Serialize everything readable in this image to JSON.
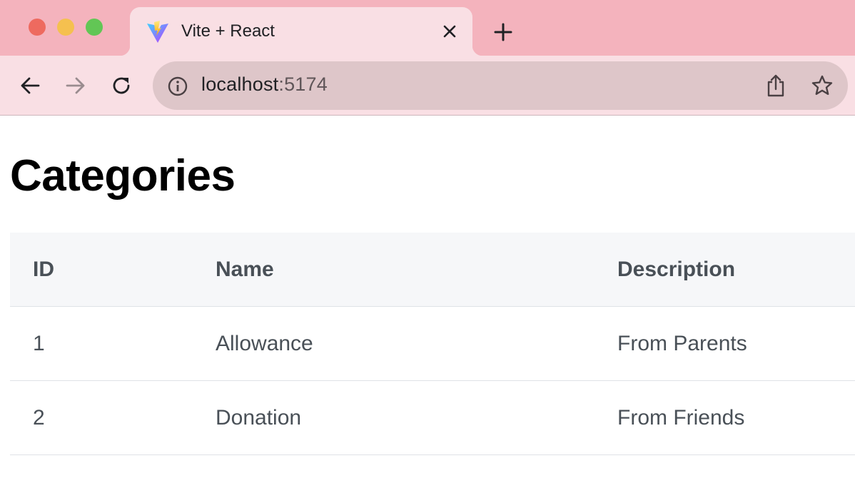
{
  "browser": {
    "tab": {
      "title": "Vite + React",
      "favicon": "vite-logo-icon"
    },
    "address_bar": {
      "host": "localhost",
      "port": ":5174"
    },
    "colors": {
      "tabstrip": "#f4b3bd",
      "toolbar": "#f9dfe4",
      "omnibox": "#dec6c9"
    }
  },
  "page": {
    "title": "Categories",
    "table": {
      "columns": [
        "ID",
        "Name",
        "Description"
      ],
      "rows": [
        {
          "id": "1",
          "name": "Allowance",
          "description": "From Parents"
        },
        {
          "id": "2",
          "name": "Donation",
          "description": "From Friends"
        }
      ]
    }
  }
}
